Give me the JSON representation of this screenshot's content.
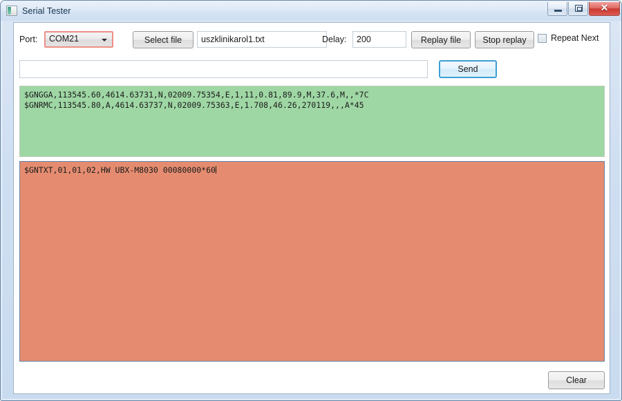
{
  "window": {
    "title": "Serial Tester",
    "icon": "window-form-icon",
    "controls": {
      "minimize": "minimize-button",
      "maximize": "maximize-button",
      "close_glyph": "✕"
    }
  },
  "toolbar": {
    "port_label": "Port:",
    "port_value": "COM21",
    "port_border_color": "#ef8e86",
    "select_file_label": "Select file",
    "file_value": "uszklinikarol1.txt",
    "delay_label": "Delay:",
    "delay_value": "200",
    "replay_file_label": "Replay file",
    "stop_replay_label": "Stop replay",
    "repeat_next_label": "Repeat Next",
    "repeat_next_checked": false
  },
  "send_row": {
    "input_value": "",
    "input_placeholder": "",
    "send_label": "Send",
    "send_focus_color": "#3c9fd6"
  },
  "received_log": {
    "background": "#9fd7a4",
    "lines": [
      "$GNGGA,113545.60,4614.63731,N,02009.75354,E,1,11,0.81,89.9,M,37.6,M,,*7C",
      "$GNRMC,113545.80,A,4614.63737,N,02009.75363,E,1.708,46.26,270119,,,A*45"
    ],
    "text": "$GNGGA,113545.60,4614.63731,N,02009.75354,E,1,11,0.81,89.9,M,37.6,M,,*7C\n$GNRMC,113545.80,A,4614.63737,N,02009.75363,E,1.708,46.26,270119,,,A*45"
  },
  "sent_log": {
    "background": "#e58c70",
    "lines": [
      "$GNTXT,01,01,02,HW UBX-M8030 00080000*60"
    ],
    "text": "$GNTXT,01,01,02,HW UBX-M8030 00080000*60"
  },
  "footer": {
    "clear_label": "Clear"
  }
}
